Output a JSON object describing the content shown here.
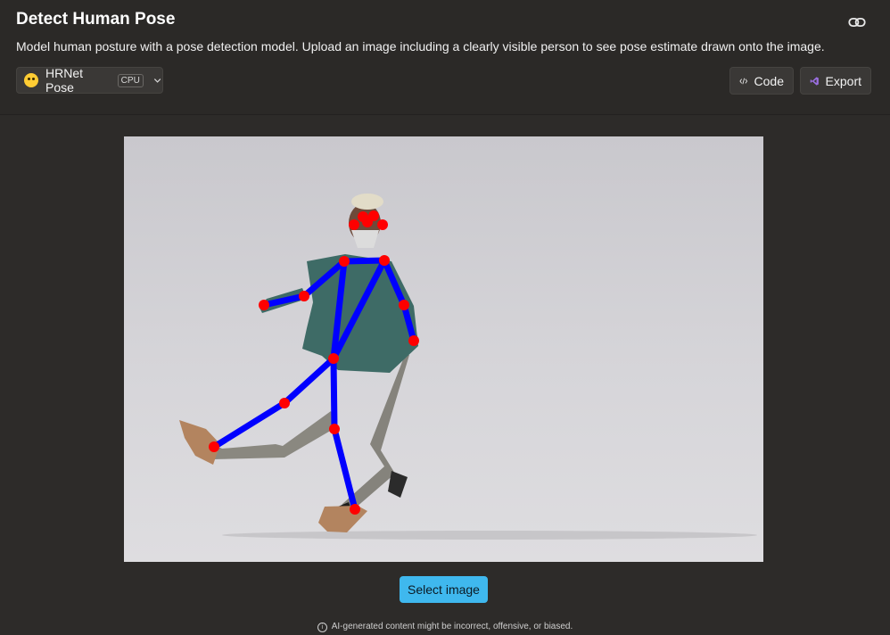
{
  "header": {
    "title": "Detect Human Pose",
    "description": "Model human posture with a pose detection model. Upload an image including a clearly visible person to see pose estimate drawn onto the image."
  },
  "model_selector": {
    "icon": "hugging-face-emoji-icon",
    "name": "HRNet Pose",
    "badge": "CPU"
  },
  "toolbar": {
    "code_label": "Code",
    "export_label": "Export"
  },
  "actions": {
    "select_image_label": "Select image"
  },
  "footer": {
    "disclaimer": "AI-generated content might be incorrect, offensive, or biased."
  },
  "colors": {
    "skeleton": "#0000ff",
    "keypoint": "#ff0000",
    "accent": "#3fb8ee"
  }
}
